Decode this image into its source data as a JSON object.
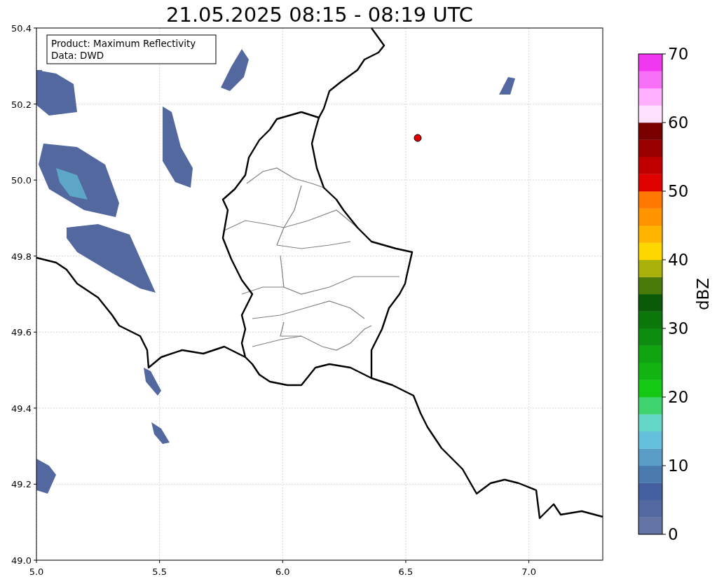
{
  "title": "21.05.2025 08:15 - 08:19 UTC",
  "info_box": [
    "Product: Maximum Reflectivity",
    "Data: DWD"
  ],
  "x_ticks": [
    "5.0",
    "5.5",
    "6.0",
    "6.5",
    "7.0"
  ],
  "y_ticks": [
    "50.4",
    "50.2",
    "50.0",
    "49.8",
    "49.6",
    "49.4",
    "49.2",
    "49.0"
  ],
  "colorbar": {
    "label": "dBZ",
    "ticks": [
      "70",
      "60",
      "50",
      "40",
      "30",
      "20",
      "10",
      "0"
    ],
    "bands": [
      {
        "color": "#6474a4"
      },
      {
        "color": "#5468a0"
      },
      {
        "color": "#4560a0"
      },
      {
        "color": "#4a7ab0"
      },
      {
        "color": "#5a9ec8"
      },
      {
        "color": "#64c0dc"
      },
      {
        "color": "#64d8c8"
      },
      {
        "color": "#40d470"
      },
      {
        "color": "#14c814"
      },
      {
        "color": "#12b412"
      },
      {
        "color": "#10a410"
      },
      {
        "color": "#0e8c10"
      },
      {
        "color": "#0c780c"
      },
      {
        "color": "#0a5a0a"
      },
      {
        "color": "#4a7a0a"
      },
      {
        "color": "#aab00a"
      },
      {
        "color": "#ffd700"
      },
      {
        "color": "#ffb400"
      },
      {
        "color": "#ff9400"
      },
      {
        "color": "#ff7800"
      },
      {
        "color": "#e00000"
      },
      {
        "color": "#c00000"
      },
      {
        "color": "#9a0000"
      },
      {
        "color": "#780000"
      },
      {
        "color": "#ffe0ff"
      },
      {
        "color": "#ffb0ff"
      },
      {
        "color": "#f870f8"
      },
      {
        "color": "#f038f0"
      }
    ]
  }
}
